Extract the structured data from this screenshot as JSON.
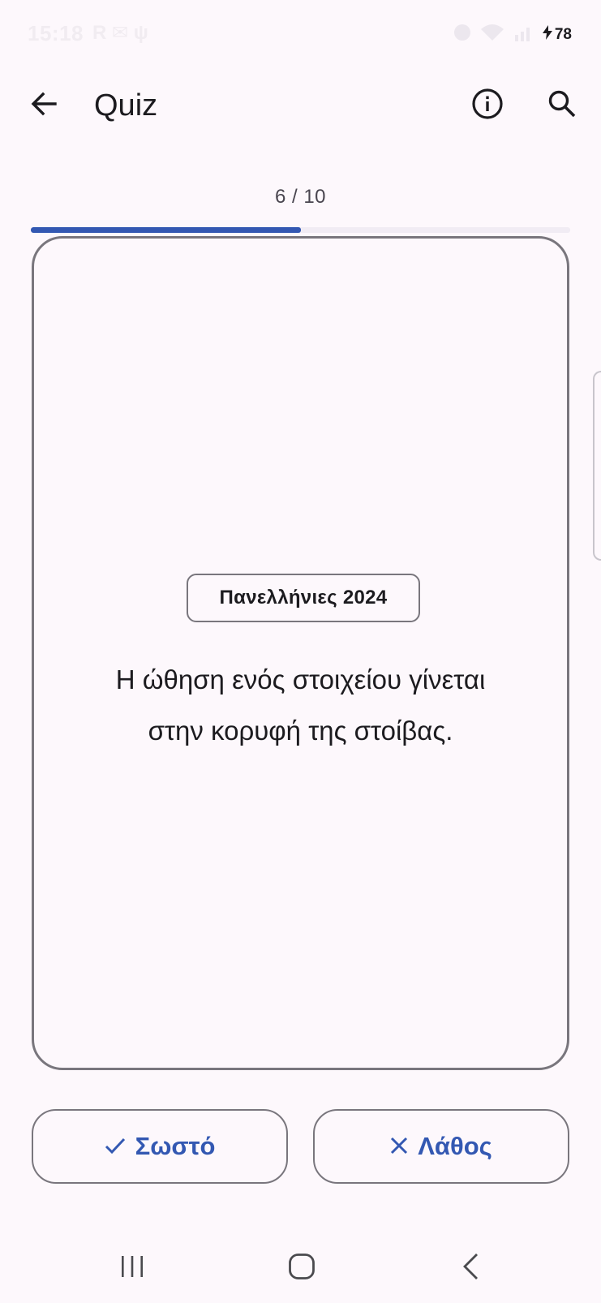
{
  "status_bar": {
    "time": "15:18",
    "left_icons": "R ✉ ψ",
    "battery_level": "78"
  },
  "app_bar": {
    "title": "Quiz",
    "icons": [
      "arrow-back-icon",
      "info-icon",
      "search-icon"
    ]
  },
  "progress": {
    "label": "6 / 10",
    "current": 6,
    "total": 10,
    "fill_fraction": 0.5,
    "fill_color": "#3358b2"
  },
  "card": {
    "source_chip": "Πανελλήνιες 2024",
    "question_line1": "Η ώθηση ενός στοιχείου γίνεται",
    "question_line2": "στην κορυφή της στοίβας."
  },
  "answers": {
    "correct_label": "Σωστό",
    "correct_icon": "check-icon",
    "wrong_label": "Λάθος",
    "wrong_icon": "close-icon",
    "accent_color": "#3358b2"
  },
  "nav_bar": {
    "icons": [
      "recents-icon",
      "home-icon",
      "back-icon"
    ]
  }
}
